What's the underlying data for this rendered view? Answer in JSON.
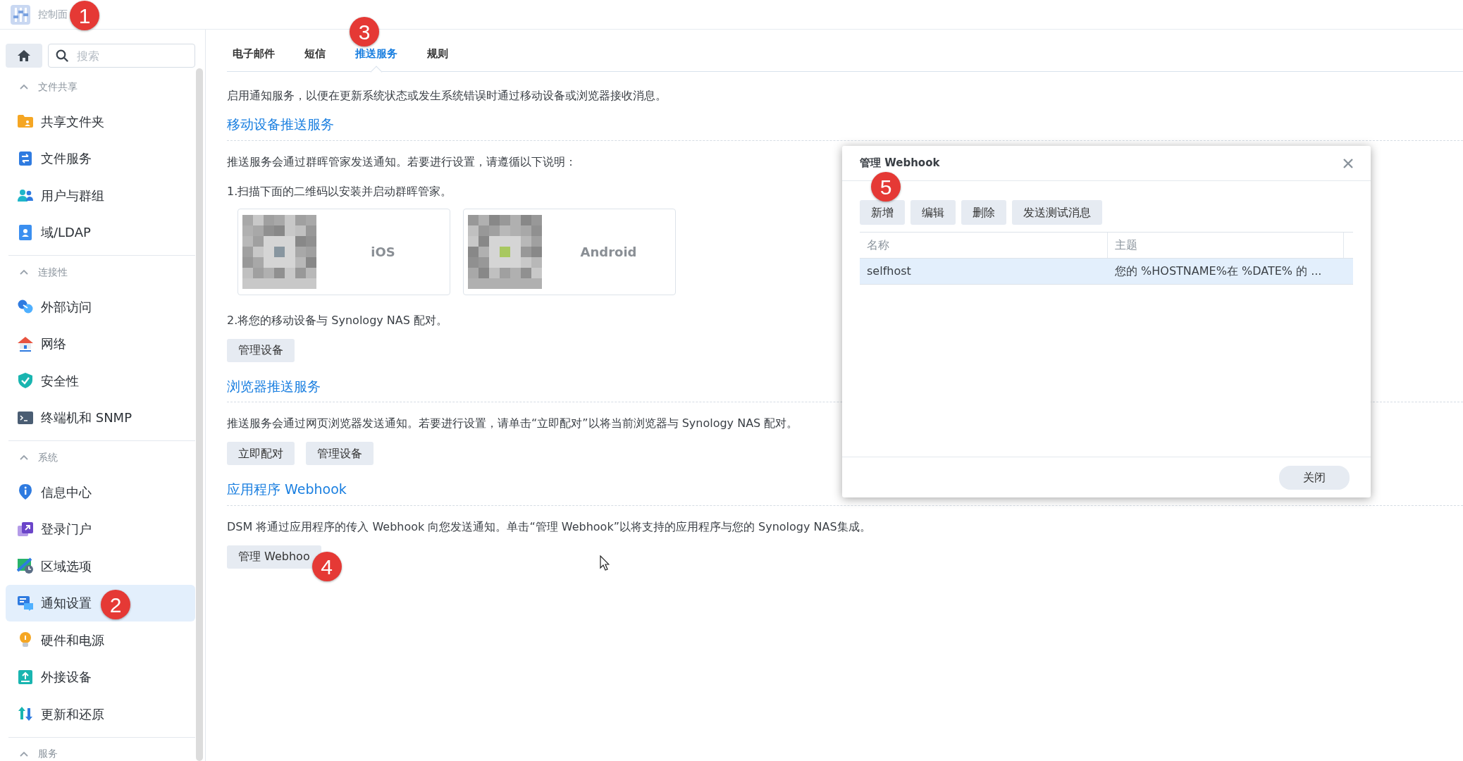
{
  "window": {
    "title": "控制面"
  },
  "sidebar": {
    "search": {
      "placeholder": "搜索"
    },
    "sections": [
      {
        "title": "文件共享",
        "expanded": true,
        "items": [
          {
            "label": "共享文件夹",
            "selected": false
          },
          {
            "label": "文件服务",
            "selected": false
          },
          {
            "label": "用户与群组",
            "selected": false
          },
          {
            "label": "域/LDAP",
            "selected": false
          }
        ]
      },
      {
        "title": "连接性",
        "expanded": true,
        "items": [
          {
            "label": "外部访问",
            "selected": false
          },
          {
            "label": "网络",
            "selected": false
          },
          {
            "label": "安全性",
            "selected": false
          },
          {
            "label": "终端机和 SNMP",
            "selected": false
          }
        ]
      },
      {
        "title": "系统",
        "expanded": true,
        "items": [
          {
            "label": "信息中心",
            "selected": false
          },
          {
            "label": "登录门户",
            "selected": false
          },
          {
            "label": "区域选项",
            "selected": false
          },
          {
            "label": "通知设置",
            "selected": true
          },
          {
            "label": "硬件和电源",
            "selected": false
          },
          {
            "label": "外接设备",
            "selected": false
          },
          {
            "label": "更新和还原",
            "selected": false
          }
        ]
      },
      {
        "title": "服务",
        "expanded": true
      }
    ]
  },
  "tabs": [
    {
      "label": "电子邮件",
      "selected": false
    },
    {
      "label": "短信",
      "selected": false
    },
    {
      "label": "推送服务",
      "selected": true
    },
    {
      "label": "规则",
      "selected": false
    }
  ],
  "intro": "启用通知服务，以便在更新系统状态或发生系统错误时通过移动设备或浏览器接收消息。",
  "sections": [
    {
      "title": "移动设备推送服务",
      "paragraphs": [
        "推送服务会通过群晖管家发送通知。若要进行设置，请遵循以下说明：",
        "1.扫描下面的二维码以安装并启动群晖管家。"
      ],
      "apps": [
        {
          "label": "iOS"
        },
        {
          "label": "Android"
        }
      ],
      "after": "2.将您的移动设备与 Synology NAS 配对。",
      "buttons": [
        "管理设备"
      ]
    },
    {
      "title": "浏览器推送服务",
      "paragraphs": [
        "推送服务会通过网页浏览器发送通知。若要进行设置，请单击“立即配对”以将当前浏览器与 Synology NAS 配对。"
      ],
      "buttons": [
        "立即配对",
        "管理设备"
      ]
    },
    {
      "title": "应用程序 Webhook",
      "paragraphs": [
        "DSM 将通过应用程序的传入 Webhook 向您发送通知。单击“管理 Webhook”以将支持的应用程序与您的 Synology NAS集成。"
      ],
      "buttons": [
        "管理 Webhoo"
      ]
    }
  ],
  "dialog": {
    "title": "管理 Webhook",
    "toolbar": [
      "新增",
      "编辑",
      "删除",
      "发送测试消息"
    ],
    "columns": [
      "名称",
      "主题"
    ],
    "rows": [
      {
        "cells": [
          "selfhost",
          "您的 %HOSTNAME%在 %DATE% 的 ..."
        ],
        "selected": true
      }
    ],
    "footer_button": "关闭"
  },
  "callouts": [
    "1",
    "2",
    "3",
    "4",
    "5"
  ]
}
